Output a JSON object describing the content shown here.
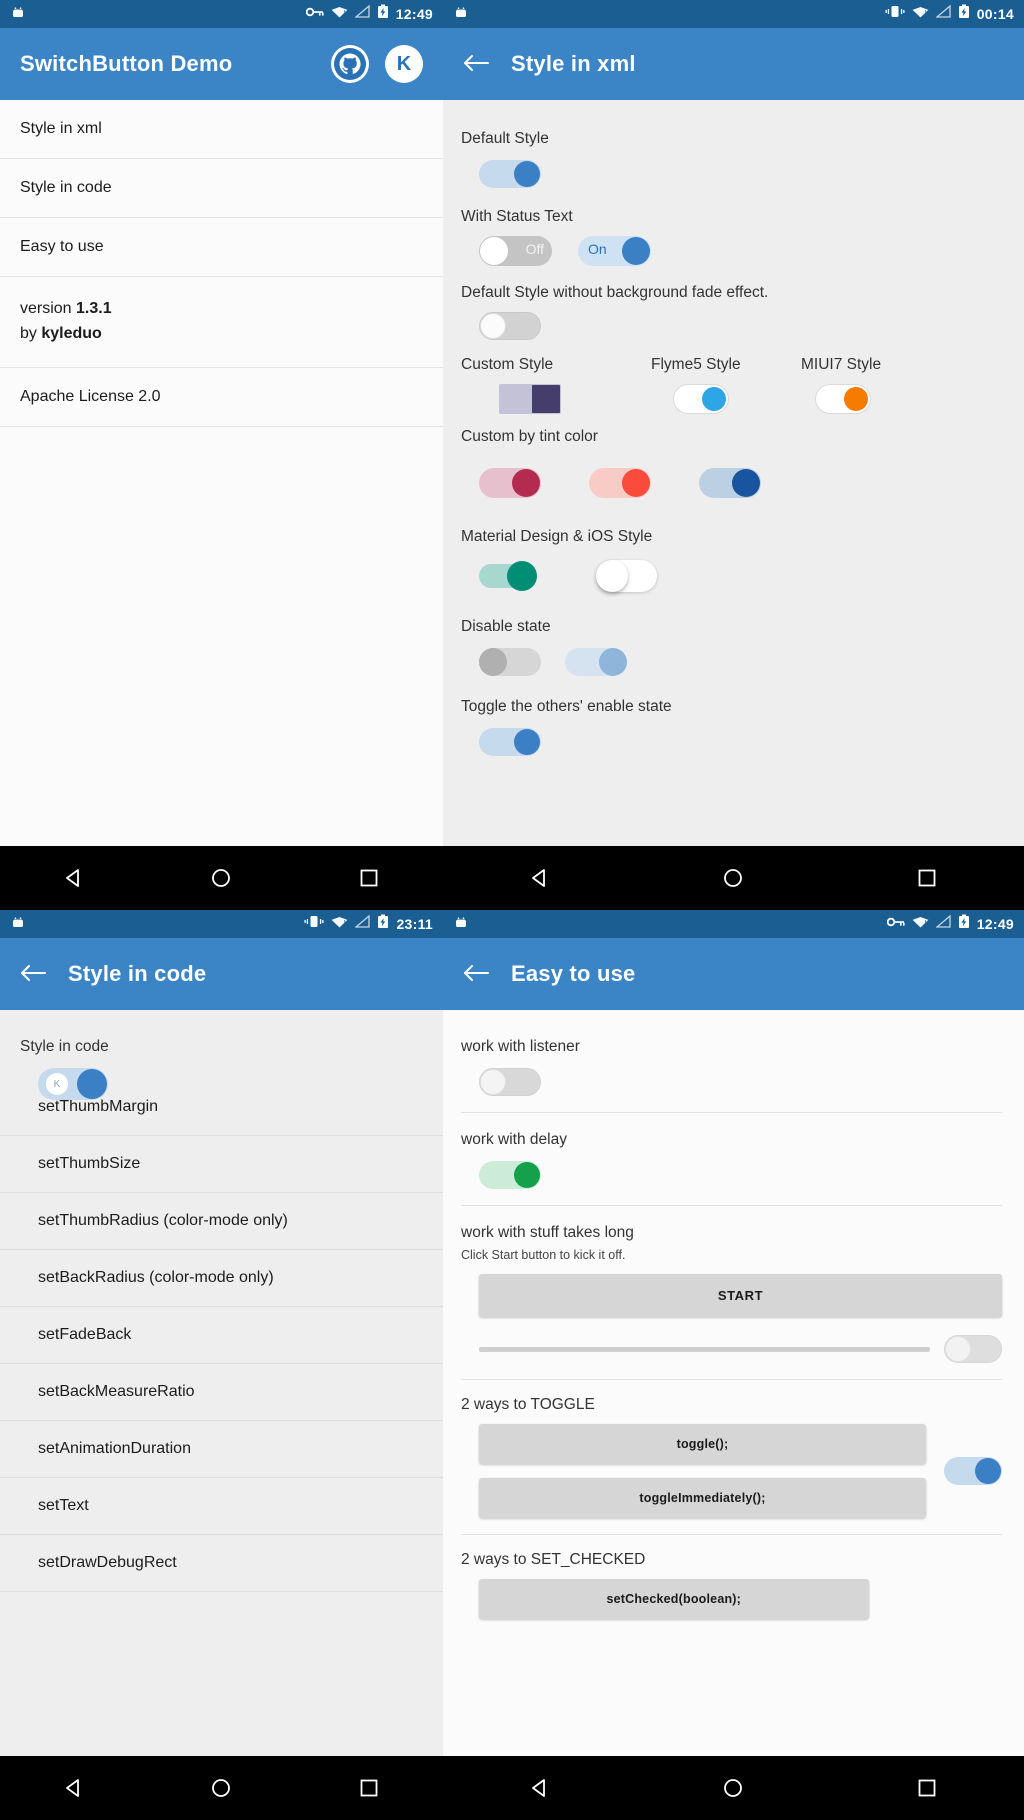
{
  "screens": {
    "home": {
      "status": {
        "time": "12:49",
        "icons": [
          "android-icon",
          "key-icon",
          "wifi-alert-icon",
          "signal-icon",
          "battery-charging-icon"
        ]
      },
      "appbar": {
        "title": "SwitchButton Demo",
        "github_icon": "github-icon",
        "avatar_letter": "K"
      },
      "items": [
        {
          "label": "Style in xml"
        },
        {
          "label": "Style in code"
        },
        {
          "label": "Easy to use"
        }
      ],
      "version_line1_prefix": "version ",
      "version_line1_value": "1.3.1",
      "version_line2_prefix": "by ",
      "version_line2_value": "kyleduo",
      "license": "Apache License 2.0"
    },
    "xml": {
      "status": {
        "time": "00:14",
        "icons": [
          "android-icon",
          "vibrate-icon",
          "wifi-alert-icon",
          "signal-icon",
          "battery-charging-icon"
        ]
      },
      "appbar": {
        "title": "Style in xml",
        "back_icon": "back-arrow-icon"
      },
      "sections": {
        "default_style": "Default Style",
        "with_status_text": "With Status Text",
        "status_off": "Off",
        "status_on": "On",
        "no_fade": "Default Style without background fade effect.",
        "custom_style": "Custom Style",
        "flyme5": "Flyme5 Style",
        "miui7": "MIUI7 Style",
        "tint_color": "Custom by tint color",
        "material_ios": "Material Design & iOS Style",
        "disable_state": "Disable state",
        "toggle_others": "Toggle the others' enable state"
      },
      "colors": {
        "default_thumb": "#3b7fc4",
        "default_track": "#c6daee",
        "off_thumb": "#ffffff",
        "off_track": "#c4c4c4",
        "on_thumb": "#3b7fc4",
        "on_track": "#cfe2f3",
        "custom_thumb": "#453d6b",
        "custom_track": "#c4c2d6",
        "flyme_thumb": "#2ea5e4",
        "flyme_track": "#ffffff",
        "miui_thumb": "#f57c00",
        "miui_track": "#ffffff",
        "tint_pink_thumb": "#b42b52",
        "tint_pink_track": "#e7c0cd",
        "tint_red_thumb": "#fb4b3c",
        "tint_red_track": "#f8cbc7",
        "tint_blue_thumb": "#19549f",
        "tint_blue_track": "#bcd0e4",
        "material_thumb": "#008e76",
        "material_track": "#a7d8cf",
        "ios_thumb": "#ffffff",
        "ios_track": "#ffffff",
        "disable_gray_thumb": "#b0b0b0",
        "disable_gray_track": "#d6d6d6",
        "disable_blue_thumb": "#8fb5da",
        "disable_blue_track": "#d5e3f0",
        "toggle_thumb": "#3b7fc4",
        "toggle_track": "#c6daee"
      }
    },
    "code": {
      "status": {
        "time": "23:11",
        "icons": [
          "android-icon",
          "vibrate-icon",
          "wifi-alert-icon",
          "signal-icon",
          "battery-charging-icon"
        ]
      },
      "appbar": {
        "title": "Style in code",
        "back_icon": "back-arrow-icon"
      },
      "header_label": "Style in code",
      "header_thumb_letter": "K",
      "items": [
        "setThumbMargin",
        "setThumbSize",
        "setThumbRadius (color-mode only)",
        "setBackRadius (color-mode only)",
        "setFadeBack",
        "setBackMeasureRatio",
        "setAnimationDuration",
        "setText",
        "setDrawDebugRect"
      ],
      "colors": {
        "thumb": "#3b7fc4",
        "track": "#c6daee"
      }
    },
    "easy": {
      "status": {
        "time": "12:49",
        "icons": [
          "android-icon",
          "key-icon",
          "wifi-alert-icon",
          "signal-icon",
          "battery-charging-icon"
        ]
      },
      "appbar": {
        "title": "Easy to use",
        "back_icon": "back-arrow-icon"
      },
      "listener_label": "work with listener",
      "delay_label": "work with delay",
      "long_label": "work with stuff takes long",
      "long_hint": "Click Start button to kick it off.",
      "start_button": "START",
      "toggle_heading": "2 ways to TOGGLE",
      "toggle_btn1": "toggle();",
      "toggle_btn2": "toggleImmediately();",
      "setchecked_heading": "2 ways to SET_CHECKED",
      "setchecked_btn1": "setChecked(boolean);",
      "colors": {
        "listener_thumb": "#f4f4f4",
        "listener_track": "#d8d8d8",
        "delay_thumb": "#15a04b",
        "delay_track": "#cdebd9",
        "progress_thumb": "#f2f2f2",
        "progress_track": "#dedede",
        "toggle_thumb": "#3b7fc4",
        "toggle_track": "#c6daee"
      }
    }
  },
  "nav": {
    "back": "nav-back-icon",
    "home": "nav-home-icon",
    "recent": "nav-recent-icon"
  }
}
